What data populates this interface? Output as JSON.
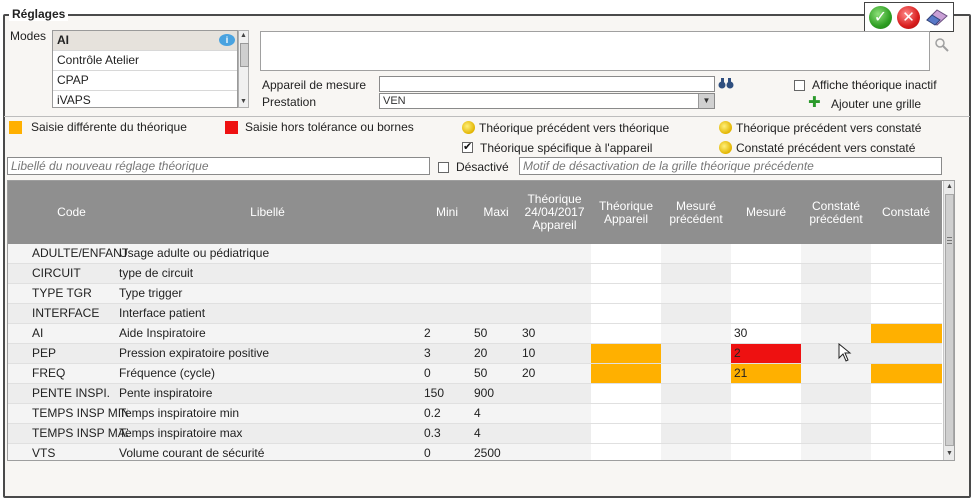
{
  "section_title": "Réglages",
  "modes_label": "Modes",
  "modes": [
    "AI",
    "Contrôle Atelier",
    "CPAP",
    "iVAPS"
  ],
  "appareil_label": "Appareil de mesure",
  "appareil_value": "",
  "prestation_label": "Prestation",
  "prestation_value": "VEN",
  "affiche_inactif_label": "Affiche théorique inactif",
  "ajouter_grille_label": "Ajouter une grille",
  "legend": {
    "saisie_diff": "Saisie différente du théorique",
    "saisie_hors": "Saisie hors tolérance ou bornes",
    "theo_prec_theo": "Théorique précédent vers théorique",
    "theo_prec_constate": "Théorique précédent vers constaté",
    "theo_specifique": "Théorique spécifique à l'appareil",
    "constate_prec_constate": "Constaté précédent vers constaté"
  },
  "libelle_placeholder": "Libellé du nouveau réglage théorique",
  "desactive_label": "Désactivé",
  "motif_placeholder": "Motif de désactivation de la grille théorique précédente",
  "colors": {
    "orange": "#ffb000",
    "red": "#ee1111",
    "header": "#8f8f8f"
  },
  "columns": {
    "code": "Code",
    "libelle": "Libellé",
    "mini": "Mini",
    "maxi": "Maxi",
    "theo_appareil_date": "Théorique 24/04/2017 Appareil",
    "theorique_appareil": "Théorique Appareil",
    "mesure_prec": "Mesuré précédent",
    "mesure": "Mesuré",
    "constate_prec": "Constaté précédent",
    "constate": "Constaté"
  },
  "rows": [
    {
      "code": "ADULTE/ENFANT",
      "libelle": "Usage adulte ou pédiatrique",
      "mini": "",
      "maxi": "",
      "theo": "",
      "mesure": "",
      "mesure_state": "empty",
      "theo_app_state": "empty",
      "constate_state": "empty"
    },
    {
      "code": "CIRCUIT",
      "libelle": "type de circuit",
      "mini": "",
      "maxi": "",
      "theo": "",
      "mesure": "",
      "mesure_state": "empty",
      "theo_app_state": "empty",
      "constate_state": "empty"
    },
    {
      "code": "TYPE TGR",
      "libelle": "Type trigger",
      "mini": "",
      "maxi": "",
      "theo": "",
      "mesure": "",
      "mesure_state": "empty",
      "theo_app_state": "empty",
      "constate_state": "empty"
    },
    {
      "code": "INTERFACE",
      "libelle": "Interface patient",
      "mini": "",
      "maxi": "",
      "theo": "",
      "mesure": "",
      "mesure_state": "empty",
      "theo_app_state": "empty",
      "constate_state": "empty"
    },
    {
      "code": "AI",
      "libelle": "Aide Inspiratoire",
      "mini": "2",
      "maxi": "50",
      "theo": "30",
      "mesure": "30",
      "mesure_state": "empty",
      "theo_app_state": "empty",
      "constate_state": "orange"
    },
    {
      "code": "PEP",
      "libelle": "Pression expiratoire positive",
      "mini": "3",
      "maxi": "20",
      "theo": "10",
      "mesure": "2",
      "mesure_state": "red",
      "theo_app_state": "orange",
      "constate_state": "none"
    },
    {
      "code": "FREQ",
      "libelle": "Fréquence (cycle)",
      "mini": "0",
      "maxi": "50",
      "theo": "20",
      "mesure": "21",
      "mesure_state": "orange",
      "theo_app_state": "orange",
      "constate_state": "orange"
    },
    {
      "code": "PENTE INSPI.",
      "libelle": "Pente inspiratoire",
      "mini": "150",
      "maxi": "900",
      "theo": "",
      "mesure": "",
      "mesure_state": "empty",
      "theo_app_state": "empty",
      "constate_state": "empty"
    },
    {
      "code": "TEMPS INSP MIN",
      "libelle": "Temps inspiratoire min",
      "mini": "0.2",
      "maxi": "4",
      "theo": "",
      "mesure": "",
      "mesure_state": "empty",
      "theo_app_state": "empty",
      "constate_state": "empty"
    },
    {
      "code": "TEMPS INSP MAX",
      "libelle": "Temps inspiratoire max",
      "mini": "0.3",
      "maxi": "4",
      "theo": "",
      "mesure": "",
      "mesure_state": "empty",
      "theo_app_state": "empty",
      "constate_state": "empty"
    },
    {
      "code": "VTS",
      "libelle": "Volume courant de sécurité",
      "mini": "0",
      "maxi": "2500",
      "theo": "",
      "mesure": "",
      "mesure_state": "empty",
      "theo_app_state": "empty",
      "constate_state": "empty"
    }
  ]
}
